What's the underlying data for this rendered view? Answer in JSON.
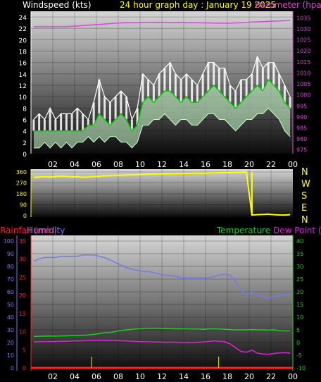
{
  "header": {
    "windspeed_label": "Windspeed (kts)",
    "date_label": "24 hour graph day : January 19 2025",
    "barometer_label": "Barometer (hpa"
  },
  "compass": [
    "N",
    "W",
    "S",
    "E",
    "N"
  ],
  "bottom_header": {
    "rainfall_label": "Rainfall (mm)",
    "humidity_label": "Humidity",
    "temperature_label": "Temperature",
    "dewpoint_label": "Dew Point (c"
  },
  "colors": {
    "gust": "#ffffff",
    "windspeed": "#00cc00",
    "windspeed_fill": "#ccffcc",
    "barometer": "#dd44dd",
    "direction": "#ffff00",
    "humidity": "#7777ee",
    "temperature": "#22cc22",
    "dewpoint": "#dd22dd",
    "rainfall": "#ff2222",
    "rain_tick": "#cccc00"
  },
  "chart_data": [
    {
      "type": "line",
      "x_ticks": [
        "02",
        "04",
        "06",
        "08",
        "10",
        "12",
        "14",
        "16",
        "18",
        "20",
        "22",
        "00"
      ],
      "y_left_ticks": [
        0,
        2,
        4,
        6,
        8,
        10,
        12,
        14,
        16,
        18,
        20,
        22,
        24
      ],
      "y_left_range": [
        0,
        25
      ],
      "y_right_ticks": [
        975,
        980,
        985,
        990,
        995,
        1000,
        1005,
        1010,
        1015,
        1020,
        1025,
        1030,
        1035
      ],
      "y_right_range": [
        973.3,
        1038
      ],
      "series": [
        {
          "name": "Windspeed (kts)",
          "axis": "left",
          "role": "gust",
          "values": [
            6,
            7,
            6,
            8,
            6,
            7,
            7,
            7,
            8,
            7,
            6,
            9,
            13,
            10,
            9,
            10,
            11,
            10,
            6,
            8,
            14,
            13,
            12,
            14,
            15,
            16,
            14,
            13,
            14,
            13,
            12,
            14,
            16,
            16,
            15,
            15,
            12,
            11,
            13,
            13,
            14,
            17,
            15,
            16,
            16,
            14,
            12,
            10
          ]
        },
        {
          "name": "Windspeed (kts)",
          "axis": "left",
          "role": "avg",
          "values": [
            4,
            4,
            4,
            4,
            4,
            4,
            4,
            4,
            4,
            4,
            5,
            5,
            7,
            6,
            5,
            6,
            7,
            6,
            4,
            5,
            9,
            10,
            9,
            10,
            11,
            11,
            10,
            9,
            10,
            9,
            9,
            10,
            11,
            12,
            11,
            10,
            9,
            8,
            9,
            10,
            11,
            12,
            11,
            13,
            12,
            11,
            9,
            8
          ]
        },
        {
          "name": "Windspeed (kts)",
          "axis": "left",
          "role": "low",
          "values": [
            1,
            1,
            2,
            1,
            2,
            1,
            2,
            1,
            2,
            2,
            3,
            2,
            3,
            2,
            3,
            3,
            2,
            2,
            1,
            2,
            5,
            5,
            6,
            6,
            7,
            6,
            5,
            6,
            6,
            5,
            5,
            6,
            7,
            7,
            6,
            6,
            5,
            4,
            5,
            6,
            6,
            7,
            7,
            8,
            7,
            6,
            4,
            3
          ]
        },
        {
          "name": "Barometer (hpa",
          "axis": "right",
          "values": [
            1031,
            1031,
            1031,
            1031,
            1031,
            1031,
            1031,
            1031.2,
            1031.3,
            1031.5,
            1031.7,
            1031.9,
            1032,
            1032.2,
            1032.4,
            1032.6,
            1032.7,
            1032.8,
            1032.8,
            1032.8,
            1033,
            1033,
            1033,
            1033,
            1033,
            1032.9,
            1032.9,
            1032.9,
            1032.8,
            1032.8,
            1032.8,
            1032.7,
            1032.7,
            1032.6,
            1032.6,
            1032.6,
            1032.6,
            1032.7,
            1032.8,
            1032.9,
            1033.1,
            1033.2,
            1033.3,
            1033.4,
            1033.5,
            1033.6,
            1033.7,
            1033.8
          ]
        }
      ]
    },
    {
      "type": "line",
      "x_ticks": [
        "02",
        "04",
        "06",
        "08",
        "10",
        "12",
        "14",
        "16",
        "18",
        "20",
        "22",
        "00"
      ],
      "y_ticks": [
        0,
        90,
        180,
        270,
        360
      ],
      "y_range": [
        0,
        360
      ],
      "series": [
        {
          "name": "Wind direction",
          "values": [
            315,
            318,
            320,
            317,
            322,
            325,
            323,
            319,
            320,
            316,
            318,
            322,
            324,
            328,
            330,
            332,
            333,
            335,
            336,
            338,
            340,
            342,
            344,
            345,
            345,
            346,
            347,
            348,
            348,
            350,
            351,
            350,
            352,
            353,
            354,
            355,
            355,
            356,
            357,
            358,
            5,
            8,
            10,
            12,
            8,
            6,
            5,
            8
          ]
        }
      ]
    },
    {
      "type": "line",
      "x_ticks": [
        "02",
        "04",
        "06",
        "08",
        "10",
        "12",
        "14",
        "16",
        "18",
        "20",
        "22",
        "00"
      ],
      "y_left_ticks": [
        0,
        10,
        20,
        30,
        40,
        50,
        60,
        70,
        80,
        90,
        100
      ],
      "y_left_range": [
        0,
        100
      ],
      "y_rain_ticks": [
        0,
        5,
        10,
        15,
        20,
        25,
        30,
        35
      ],
      "y_rain_range": [
        0,
        35
      ],
      "y_right_ticks": [
        -10,
        -5,
        0,
        5,
        10,
        15,
        20,
        25,
        30,
        35,
        40
      ],
      "y_right_range": [
        -10,
        40
      ],
      "series": [
        {
          "name": "Humidity",
          "axis": "left",
          "values": [
            84,
            86,
            87,
            87,
            87,
            88,
            88,
            88,
            88,
            89,
            89,
            89,
            88,
            87,
            85,
            83,
            81,
            79,
            78,
            77,
            76,
            76,
            75,
            74,
            73,
            73,
            72,
            71,
            71,
            71,
            71,
            71,
            71,
            72,
            73,
            74,
            73,
            68,
            61,
            58,
            60,
            57,
            56,
            55,
            56,
            57,
            58,
            58
          ]
        },
        {
          "name": "Temperature",
          "axis": "right",
          "values": [
            2.4,
            2.5,
            2.5,
            2.6,
            2.5,
            2.6,
            2.6,
            2.7,
            2.7,
            2.9,
            3.0,
            3.2,
            3.5,
            3.8,
            4.0,
            4.4,
            4.8,
            5.0,
            5.2,
            5.4,
            5.5,
            5.6,
            5.6,
            5.6,
            5.5,
            5.5,
            5.4,
            5.4,
            5.4,
            5.3,
            5.3,
            5.2,
            5.3,
            5.4,
            5.3,
            5.2,
            5.1,
            5.0,
            5.0,
            5.0,
            5.1,
            5.0,
            5.0,
            4.9,
            5.0,
            4.8,
            4.6,
            4.6
          ]
        },
        {
          "name": "Dew Point (c",
          "axis": "right",
          "values": [
            0.2,
            0.3,
            0.3,
            0.4,
            0.4,
            0.5,
            0.5,
            0.6,
            0.6,
            0.7,
            0.8,
            0.9,
            0.9,
            0.9,
            0.8,
            0.8,
            0.7,
            0.6,
            0.5,
            0.4,
            0.3,
            0.3,
            0.2,
            0.2,
            0.1,
            0.1,
            0.1,
            0.0,
            0.0,
            0.0,
            0.1,
            0.2,
            0.4,
            0.6,
            0.5,
            0.3,
            -0.5,
            -2.0,
            -3.5,
            -3.8,
            -3.0,
            -4.2,
            -4.5,
            -4.6,
            -4.3,
            -4.1,
            -4.0,
            -4.2
          ]
        },
        {
          "name": "Rainfall (mm)",
          "axis": "rain",
          "values": [
            0,
            0,
            0,
            0,
            0,
            0,
            0,
            0,
            0,
            0,
            0,
            0,
            0,
            0,
            0,
            0,
            0,
            0,
            0,
            0,
            0,
            0,
            0,
            0,
            0,
            0,
            0,
            0,
            0,
            0,
            0,
            0,
            0,
            0,
            0,
            0,
            0,
            0,
            0,
            0,
            0,
            0,
            0,
            0,
            0,
            0,
            0,
            0
          ]
        }
      ]
    }
  ]
}
